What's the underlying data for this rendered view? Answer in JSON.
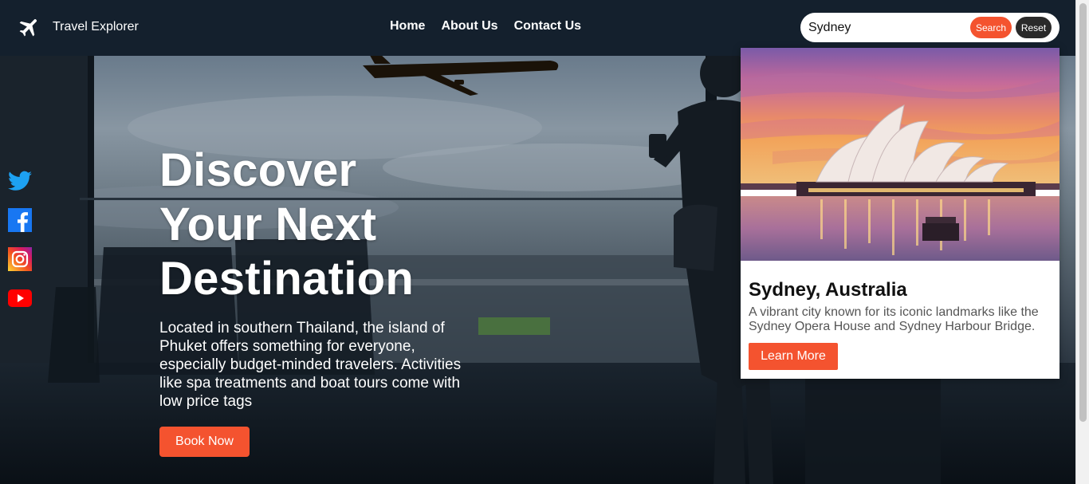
{
  "navbar": {
    "brand": "Travel Explorer",
    "links": [
      {
        "label": "Home"
      },
      {
        "label": "About Us"
      },
      {
        "label": "Contact Us"
      }
    ],
    "search": {
      "value": "Sydney",
      "search_label": "Search",
      "reset_label": "Reset"
    }
  },
  "social": [
    "twitter-icon",
    "facebook-icon",
    "instagram-icon",
    "youtube-icon"
  ],
  "hero": {
    "title_line1": "Discover",
    "title_line2": "Your Next",
    "title_line3": "Destination",
    "description": "Located in southern Thailand, the island of Phuket offers something for everyone, especially budget-minded travelers. Activities like spa treatments and boat tours come with low price tags",
    "cta": "Book Now"
  },
  "result_card": {
    "title": "Sydney, Australia",
    "description": "A vibrant city known for its iconic landmarks like the Sydney Opera House and Sydney Harbour Bridge.",
    "cta": "Learn More"
  },
  "colors": {
    "accent": "#f4532f",
    "navbar": "#14202d",
    "reset": "#2a2a2a"
  }
}
